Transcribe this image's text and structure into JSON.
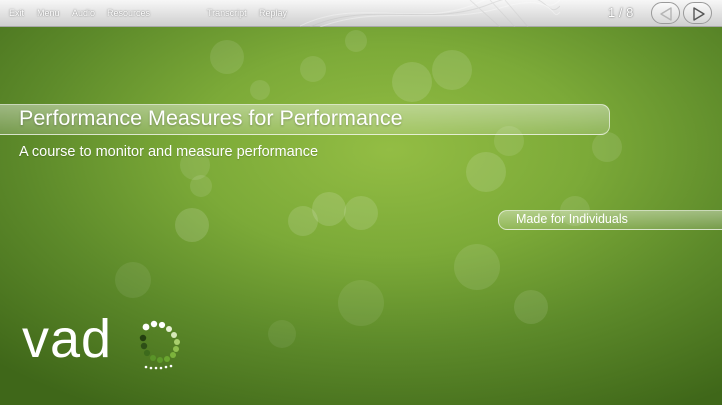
{
  "toolbar": {
    "exit_label": "Exit",
    "menu_label": "Menu",
    "audio_label": "Audio",
    "resources_label": "Resources",
    "transcript_label": "Transcript",
    "replay_label": "Replay",
    "page_counter": "1 / 8",
    "prev_icon": "triangle-left",
    "next_icon": "triangle-right"
  },
  "slide": {
    "title": "Performance Measures for Performance",
    "subtitle": "A course to monitor and measure performance",
    "tag": "Made for Individuals",
    "logo_text": "vad",
    "logo_mark": "circular dot ring (o)"
  },
  "colors": {
    "background_green": "#7caa38",
    "toolbar": "#e1e1e1",
    "text": "#ffffff",
    "logo_dots": "#6a9a2e"
  }
}
